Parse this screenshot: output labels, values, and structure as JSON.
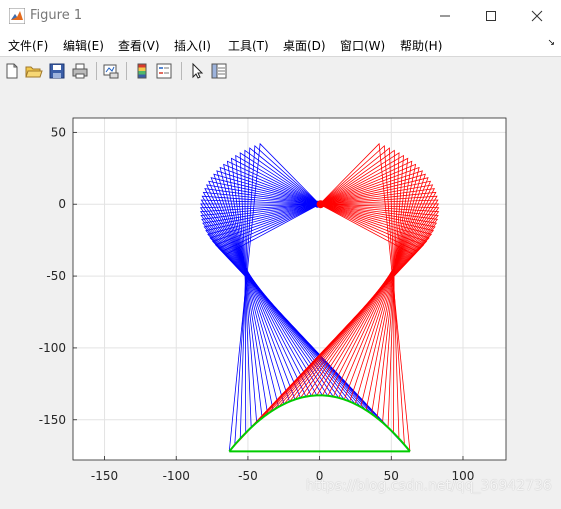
{
  "window": {
    "title": "Figure 1",
    "icons": {
      "app": "matlab-logo-icon",
      "minimize": "minimize-icon",
      "maximize": "maximize-icon",
      "close": "close-icon"
    }
  },
  "menubar": {
    "items": [
      {
        "label": "文件(F)"
      },
      {
        "label": "编辑(E)"
      },
      {
        "label": "查看(V)"
      },
      {
        "label": "插入(I)"
      },
      {
        "label": "工具(T)"
      },
      {
        "label": "桌面(D)"
      },
      {
        "label": "窗口(W)"
      },
      {
        "label": "帮助(H)"
      }
    ],
    "dock_icon": "↘"
  },
  "toolbar": {
    "buttons": [
      "new-figure-icon",
      "open-file-icon",
      "save-icon",
      "print-icon",
      "link-plot-icon",
      "colorbar-icon",
      "legend-icon",
      "edit-plot-arrow-icon",
      "property-inspector-icon"
    ]
  },
  "chart_data": {
    "type": "line",
    "title": "",
    "xlabel": "",
    "ylabel": "",
    "xlim": [
      -172,
      130
    ],
    "ylim": [
      -178,
      60
    ],
    "xticks": [
      "-150",
      "-100",
      "-50",
      "0",
      "50",
      "100"
    ],
    "yticks": [
      "50",
      "0",
      "-50",
      "-100",
      "-150"
    ],
    "xtick_values": [
      -150,
      -100,
      -50,
      0,
      50,
      100
    ],
    "ytick_values": [
      50,
      0,
      -50,
      -100,
      -150
    ],
    "grid": true,
    "series": [
      {
        "color": "#0000ff",
        "description": "left linkage line family, pivot at (0,0), knee points along left arc, ending on bottom green arc"
      },
      {
        "color": "#ff0000",
        "description": "right linkage line family, mirror of blue"
      },
      {
        "color": "#00cc00",
        "description": "green arc from (-63,-172) to (63,-172), apex y≈-133, plus baseline"
      }
    ],
    "pivot": [
      0,
      0
    ],
    "arc": {
      "x_start": -63,
      "x_end": 63,
      "y_base": -172,
      "y_apex": -133
    },
    "link_count": 34
  },
  "watermark": "https://blog.csdn.net/qq_36942736"
}
